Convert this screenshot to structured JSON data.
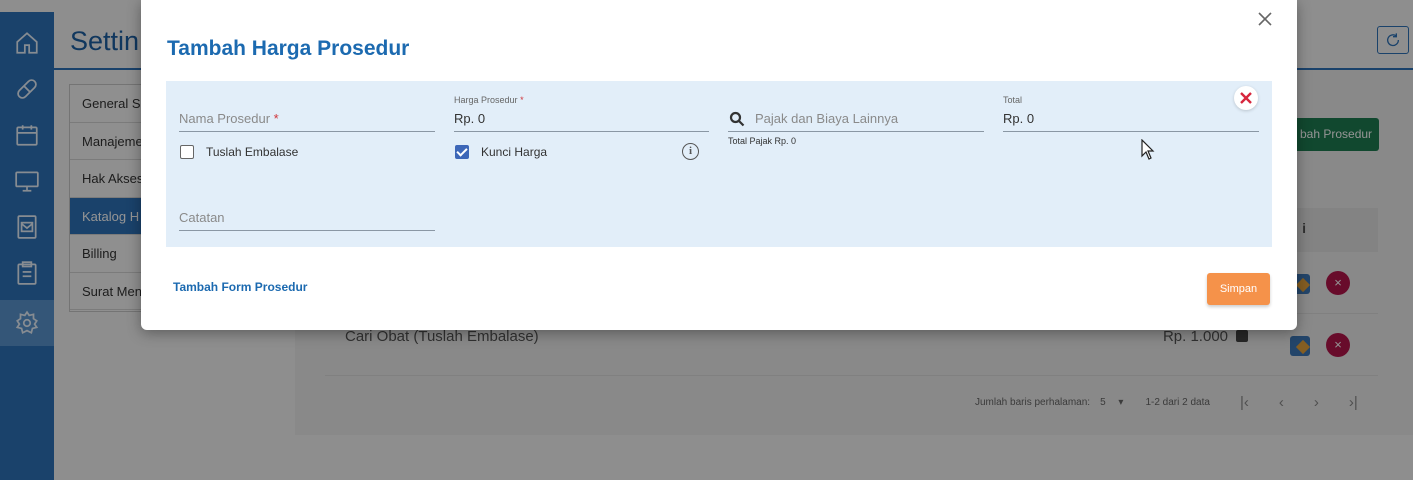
{
  "background": {
    "title": "Settin",
    "menu_items": [
      "General Se",
      "Manajeme",
      "Hak Akses",
      "Katalog H",
      "Billing",
      "Surat Men"
    ],
    "add_button": "bah Prosedur",
    "table_header_fragment": "i",
    "rows": [
      {
        "name": "",
        "price": ""
      },
      {
        "name": "Cari Obat (Tuslah Embalase)",
        "price": "Rp. 1.000"
      }
    ],
    "pagination": {
      "rows_label": "Jumlah baris perhalaman:",
      "rows_value": "5",
      "range": "1-2 dari 2 data"
    },
    "sidebar_icons": [
      "home-icon",
      "pill-icon",
      "calendar-icon",
      "monitor-icon",
      "mail-icon",
      "clipboard-icon",
      "settings-icon"
    ]
  },
  "dialog": {
    "title": "Tambah Harga Prosedur",
    "fields": {
      "nama_prosedur": {
        "placeholder": "Nama Prosedur",
        "required_mark": "*"
      },
      "harga_prosedur": {
        "label": "Harga Prosedur",
        "required_mark": "*",
        "value": "Rp. 0"
      },
      "pajak": {
        "placeholder": "Pajak dan Biaya Lainnya",
        "note": "Total Pajak Rp. 0"
      },
      "total": {
        "label": "Total",
        "value": "Rp. 0"
      },
      "catatan": {
        "placeholder": "Catatan"
      }
    },
    "checkboxes": {
      "tuslah": {
        "label": "Tuslah Embalase",
        "checked": false
      },
      "kunci": {
        "label": "Kunci Harga",
        "checked": true
      }
    },
    "add_form_link": "Tambah Form Prosedur",
    "save_button": "Simpan"
  },
  "colors": {
    "primary": "#1c6ab0",
    "form_bg": "#e2eef9",
    "save": "#f5924a",
    "remove": "#d7263d",
    "checkbox": "#3d67b8"
  }
}
